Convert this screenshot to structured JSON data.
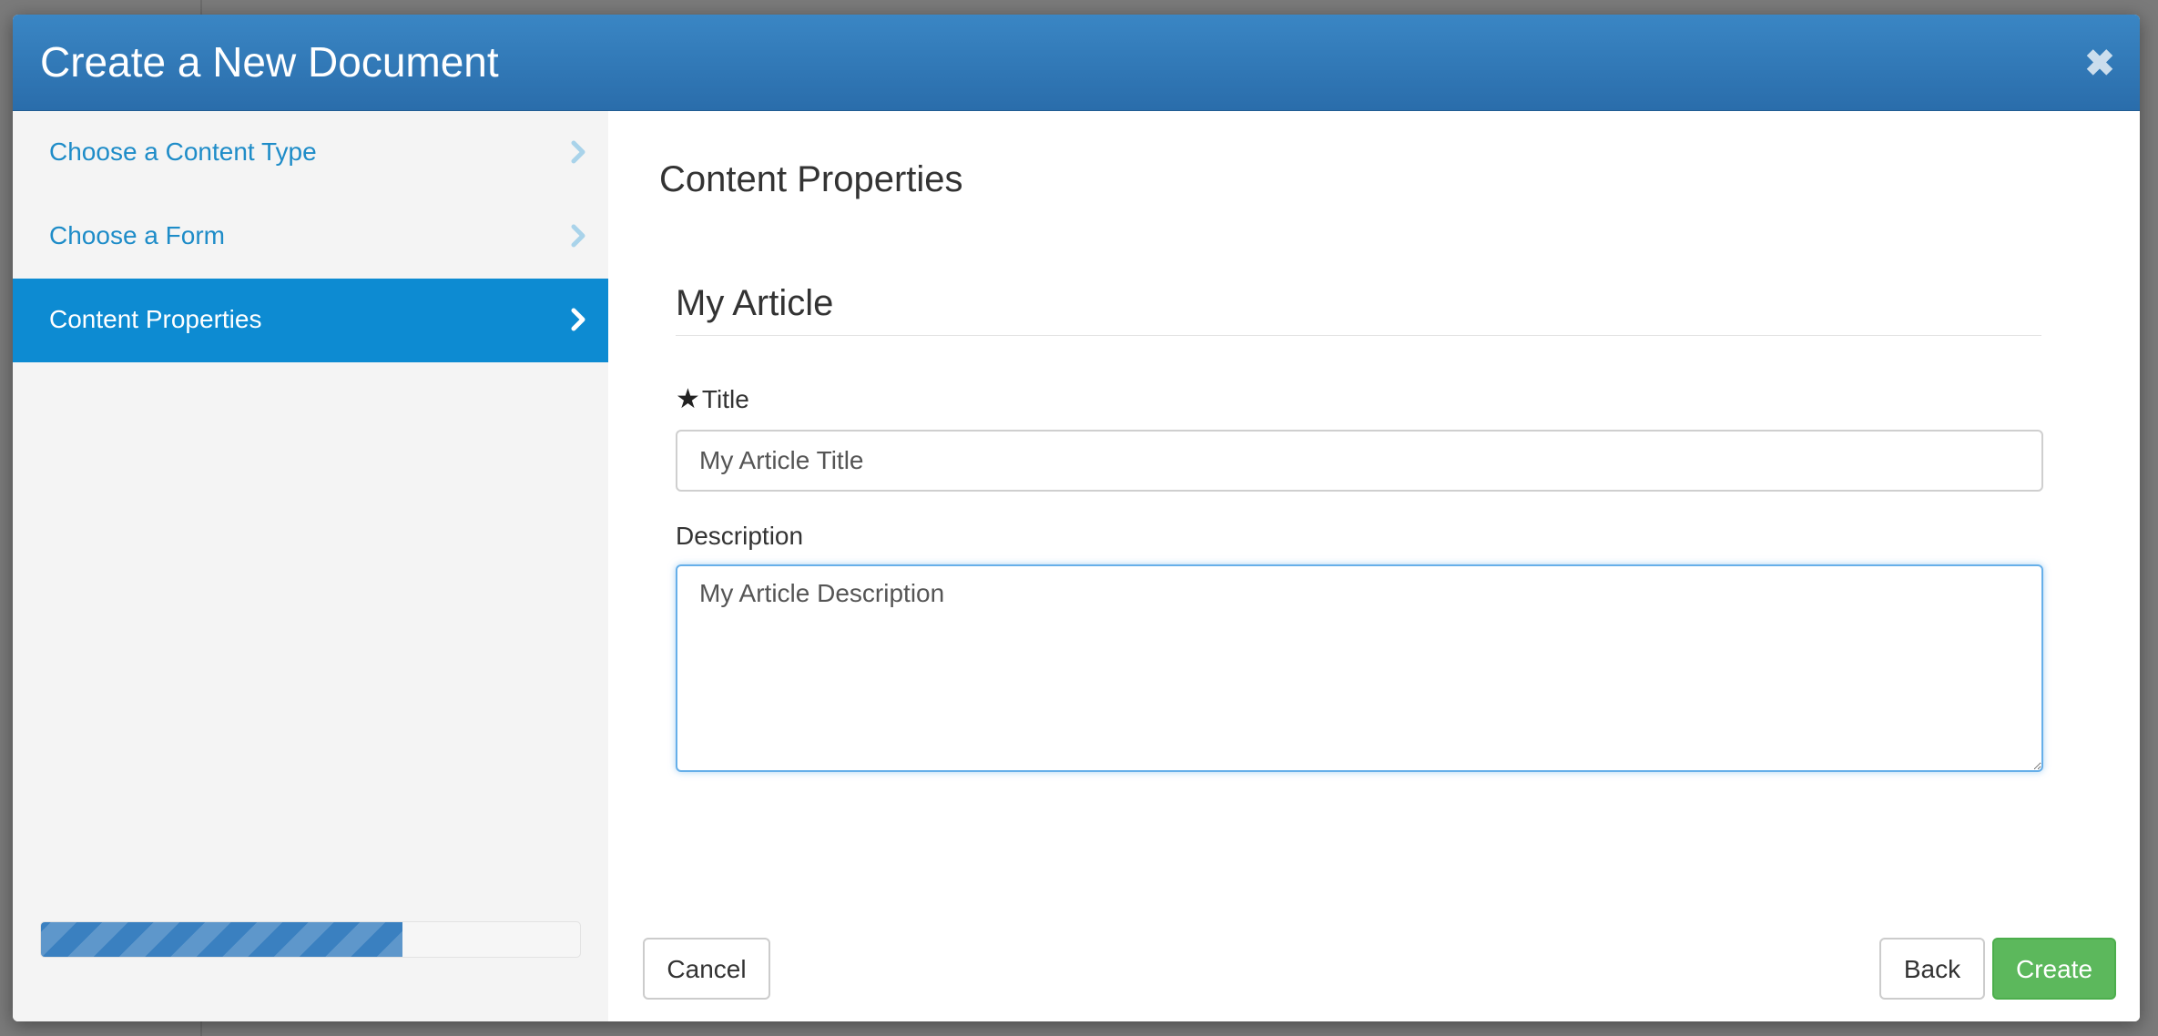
{
  "modal": {
    "title": "Create a New Document",
    "close_symbol": "✖",
    "close_icon": "close-icon"
  },
  "sidebar": {
    "items": [
      {
        "label": "Choose a Content Type",
        "icon": "chevron-right-icon",
        "active": false
      },
      {
        "label": "Choose a Form",
        "icon": "chevron-right-icon",
        "active": false
      },
      {
        "label": "Content Properties",
        "icon": "chevron-right-icon",
        "active": true
      }
    ],
    "progress": 0.67
  },
  "main": {
    "section_title": "Content Properties",
    "legend": "My Article",
    "fields": {
      "title": {
        "required_marker": "★",
        "label": "Title",
        "value": "My Article Title"
      },
      "description": {
        "label": "Description",
        "value": "My Article Description"
      }
    }
  },
  "footer": {
    "cancel_label": "Cancel",
    "back_label": "Back",
    "create_label": "Create"
  },
  "colors": {
    "header": "#2d72b0",
    "active_nav": "#0d8bd2",
    "link": "#1e8cc8",
    "progress": "#3a80c0",
    "create_button": "#5cb85c"
  }
}
